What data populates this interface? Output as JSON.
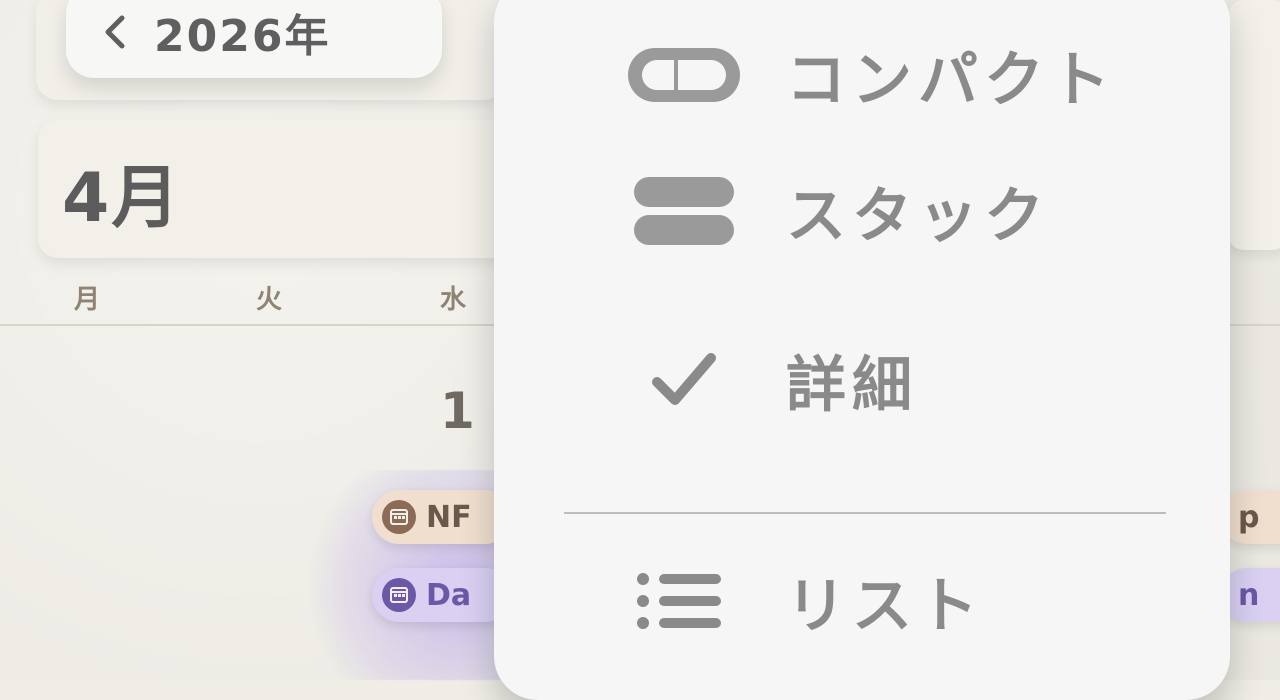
{
  "header": {
    "back_year_label": "2026年"
  },
  "calendar": {
    "month_title": "4月",
    "weekdays": [
      "月",
      "火",
      "水"
    ],
    "day_number": "1",
    "events": [
      {
        "text": "NF",
        "color": "#f0dfcf",
        "icon": "calendar-icon"
      },
      {
        "text": "Da",
        "color": "#d9d0f2",
        "icon": "calendar-icon"
      }
    ],
    "right_partial_events": [
      "p",
      "n"
    ]
  },
  "menu": {
    "items": [
      {
        "label": "コンパクト",
        "icon": "compact-pill-icon",
        "selected": false
      },
      {
        "label": "スタック",
        "icon": "stack-bars-icon",
        "selected": false
      },
      {
        "label": "詳細",
        "icon": "checkmark-icon",
        "selected": true
      },
      {
        "label": "リスト",
        "icon": "list-icon",
        "selected": false
      }
    ]
  },
  "colors": {
    "background": "#eeece5",
    "menu_background": "#f6f6f6",
    "menu_text": "#8a8a8a",
    "month_text": "#5c5c5c",
    "weekday_text": "#8f8473",
    "event_brown": "#f0dfcf",
    "event_purple": "#d9d0f2"
  }
}
